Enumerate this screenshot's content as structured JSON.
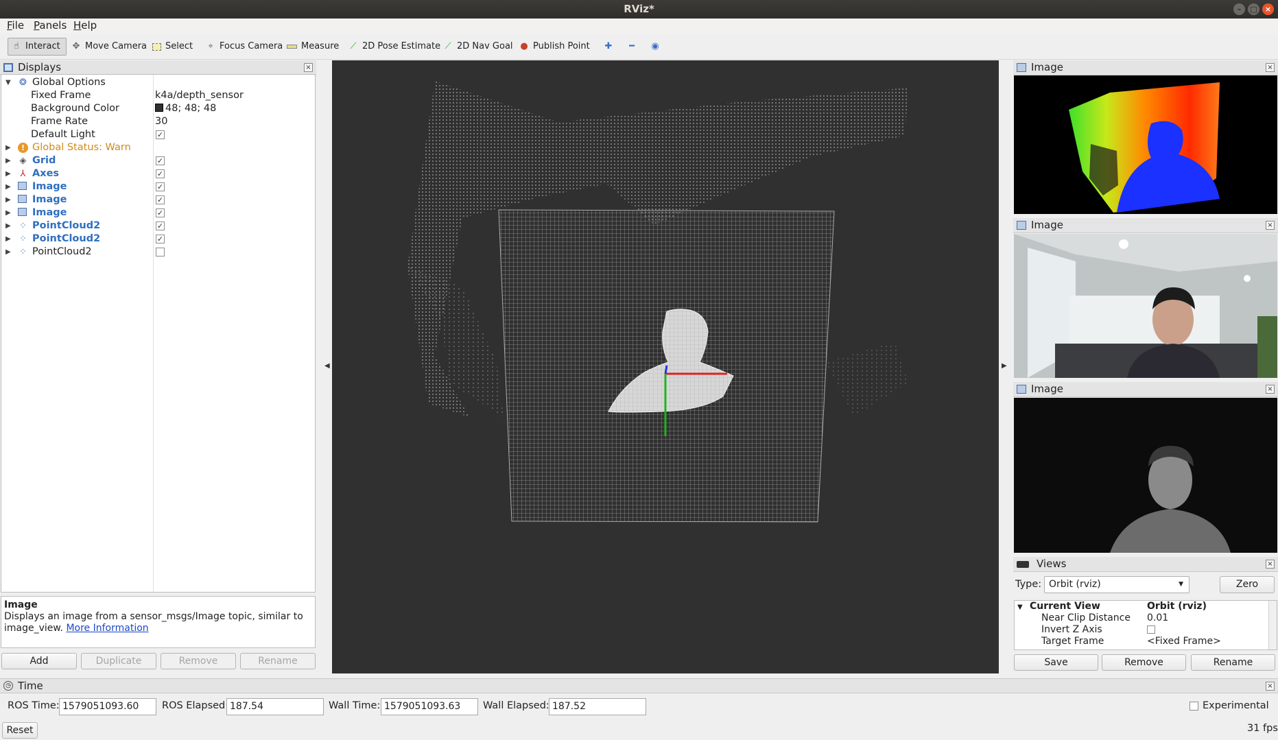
{
  "window": {
    "title": "RViz*"
  },
  "menu": [
    "File",
    "Panels",
    "Help"
  ],
  "toolbar": {
    "interact": "Interact",
    "move_camera": "Move Camera",
    "select": "Select",
    "focus_camera": "Focus Camera",
    "measure": "Measure",
    "pose_estimate": "2D Pose Estimate",
    "nav_goal": "2D Nav Goal",
    "publish_point": "Publish Point"
  },
  "displays": {
    "title": "Displays",
    "global_options": {
      "label": "Global Options",
      "fixed_frame_label": "Fixed Frame",
      "fixed_frame_value": "k4a/depth_sensor",
      "background_color_label": "Background Color",
      "background_color_value": "48; 48; 48",
      "background_color_hex": "#303030",
      "frame_rate_label": "Frame Rate",
      "frame_rate_value": "30",
      "default_light_label": "Default Light"
    },
    "global_status": "Global Status: Warn",
    "items": [
      {
        "label": "Grid",
        "icon": "grid-icon",
        "checked": true
      },
      {
        "label": "Axes",
        "icon": "axes-icon",
        "checked": true
      },
      {
        "label": "Image",
        "icon": "image-icon",
        "checked": true
      },
      {
        "label": "Image",
        "icon": "image-icon",
        "checked": true
      },
      {
        "label": "Image",
        "icon": "image-icon",
        "checked": true
      },
      {
        "label": "PointCloud2",
        "icon": "pointcloud-icon",
        "checked": true
      },
      {
        "label": "PointCloud2",
        "icon": "pointcloud-icon",
        "checked": true
      },
      {
        "label": "PointCloud2",
        "icon": "pointcloud-icon",
        "checked": false
      }
    ],
    "description": {
      "title": "Image",
      "text": "Displays an image from a sensor_msgs/Image topic, similar to image_view.",
      "text_line1": "Displays an image from a sensor_msgs/Image topic, similar to",
      "text_line2": "image_view.",
      "link": "More Information"
    },
    "buttons": {
      "add": "Add",
      "duplicate": "Duplicate",
      "remove": "Remove",
      "rename": "Rename"
    }
  },
  "image_panels": [
    "Image",
    "Image",
    "Image"
  ],
  "views": {
    "title": "Views",
    "type_label": "Type:",
    "type_value": "Orbit (rviz)",
    "zero": "Zero",
    "current_view_label": "Current View",
    "current_view_value": "Orbit (rviz)",
    "near_clip_label": "Near Clip Distance",
    "near_clip_value": "0.01",
    "invert_z_label": "Invert Z Axis",
    "target_frame_label": "Target Frame",
    "target_frame_value": "<Fixed Frame>",
    "buttons": {
      "save": "Save",
      "remove": "Remove",
      "rename": "Rename"
    }
  },
  "time": {
    "title": "Time",
    "ros_time_label": "ROS Time:",
    "ros_time": "1579051093.60",
    "ros_elapsed_label": "ROS Elapsed:",
    "ros_elapsed": "187.54",
    "wall_time_label": "Wall Time:",
    "wall_time": "1579051093.63",
    "wall_elapsed_label": "Wall Elapsed:",
    "wall_elapsed": "187.52",
    "experimental": "Experimental",
    "reset": "Reset",
    "fps": "31 fps"
  }
}
